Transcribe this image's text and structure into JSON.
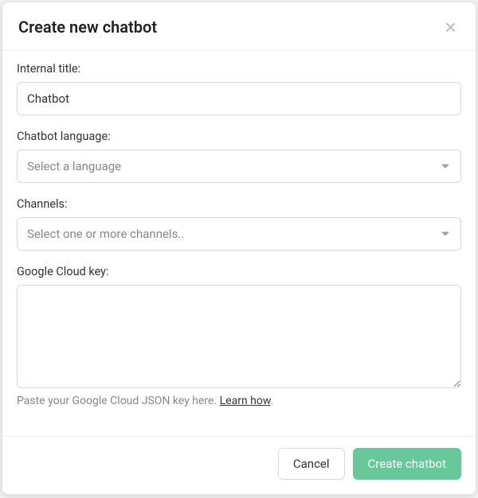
{
  "modal": {
    "title": "Create new chatbot",
    "close_label": "×"
  },
  "form": {
    "internal_title": {
      "label": "Internal title:",
      "value": "Chatbot"
    },
    "language": {
      "label": "Chatbot language:",
      "placeholder": "Select a language"
    },
    "channels": {
      "label": "Channels:",
      "placeholder": "Select one or more channels.."
    },
    "google_cloud_key": {
      "label": "Google Cloud key:",
      "value": "",
      "helper_prefix": "Paste your Google Cloud JSON key here. ",
      "helper_link_text": "Learn how",
      "helper_suffix": "."
    }
  },
  "footer": {
    "cancel_label": "Cancel",
    "submit_label": "Create chatbot"
  }
}
